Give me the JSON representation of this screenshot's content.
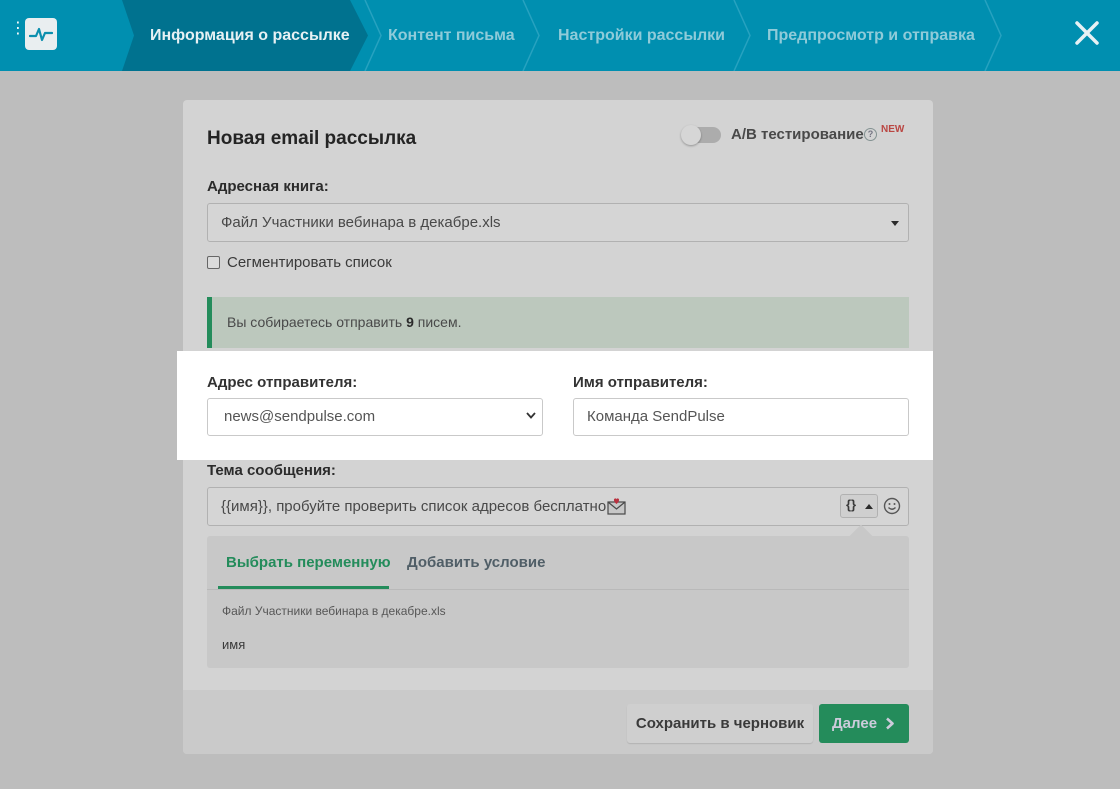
{
  "wizard": {
    "steps": [
      {
        "label": "Информация о рассылке",
        "active": true
      },
      {
        "label": "Контент письма",
        "active": false
      },
      {
        "label": "Настройки рассылки",
        "active": false
      },
      {
        "label": "Предпросмотр и отправка",
        "active": false
      }
    ],
    "close_icon": "close-icon",
    "logo_icon": "pulse-logo-icon"
  },
  "form": {
    "title": "Новая email рассылка",
    "ab_testing": {
      "label": "A/B тестирование",
      "enabled": false,
      "badge": "NEW",
      "help_icon": "question-icon"
    },
    "address_book": {
      "label": "Адресная книга:",
      "value": "Файл Участники вебинара в декабре.xls"
    },
    "segment": {
      "label": "Сегментировать список",
      "checked": false
    },
    "alert": {
      "prefix": "Вы собираетесь отправить ",
      "count": "9",
      "suffix": " писем."
    },
    "sender_address": {
      "label": "Адрес отправителя:",
      "value": "news@sendpulse.com"
    },
    "sender_name": {
      "label": "Имя отправителя:",
      "value": "Команда SendPulse"
    },
    "subject": {
      "label": "Тема сообщения:",
      "value": "{{имя}}, пробуйте проверить список адресов бесплатно",
      "variable_button": "{}"
    },
    "variables": {
      "tabs": [
        "Выбрать переменную",
        "Добавить условие"
      ],
      "active_tab": 0,
      "source": "Файл Участники вебинара в декабре.xls",
      "items": [
        "имя"
      ]
    }
  },
  "footer": {
    "save_draft": "Сохранить в черновик",
    "next": "Далее"
  },
  "colors": {
    "topbar": "#008fb0",
    "accent_green": "#2aa36b",
    "badge_red": "#d9534f"
  }
}
